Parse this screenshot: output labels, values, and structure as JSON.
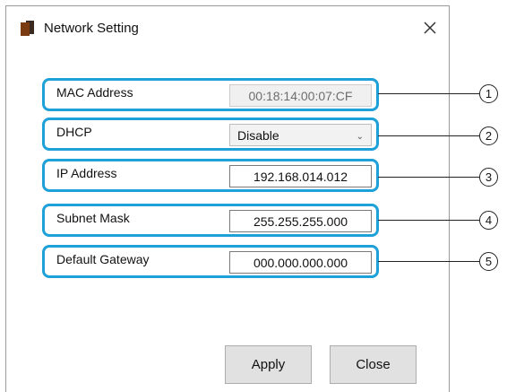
{
  "window": {
    "title": "Network Setting",
    "close_icon": "close-icon"
  },
  "rows": [
    {
      "label": "MAC Address",
      "value": "00:18:14:00:07:CF",
      "callout": "1"
    },
    {
      "label": "DHCP",
      "value": "Disable",
      "callout": "2"
    },
    {
      "label": "IP Address",
      "value": "192.168.014.012",
      "callout": "3"
    },
    {
      "label": "Subnet Mask",
      "value": "255.255.255.000",
      "callout": "4"
    },
    {
      "label": "Default Gateway",
      "value": "000.000.000.000",
      "callout": "5"
    }
  ],
  "buttons": {
    "apply": "Apply",
    "close": "Close"
  },
  "colors": {
    "highlight": "#1ea0d8"
  }
}
